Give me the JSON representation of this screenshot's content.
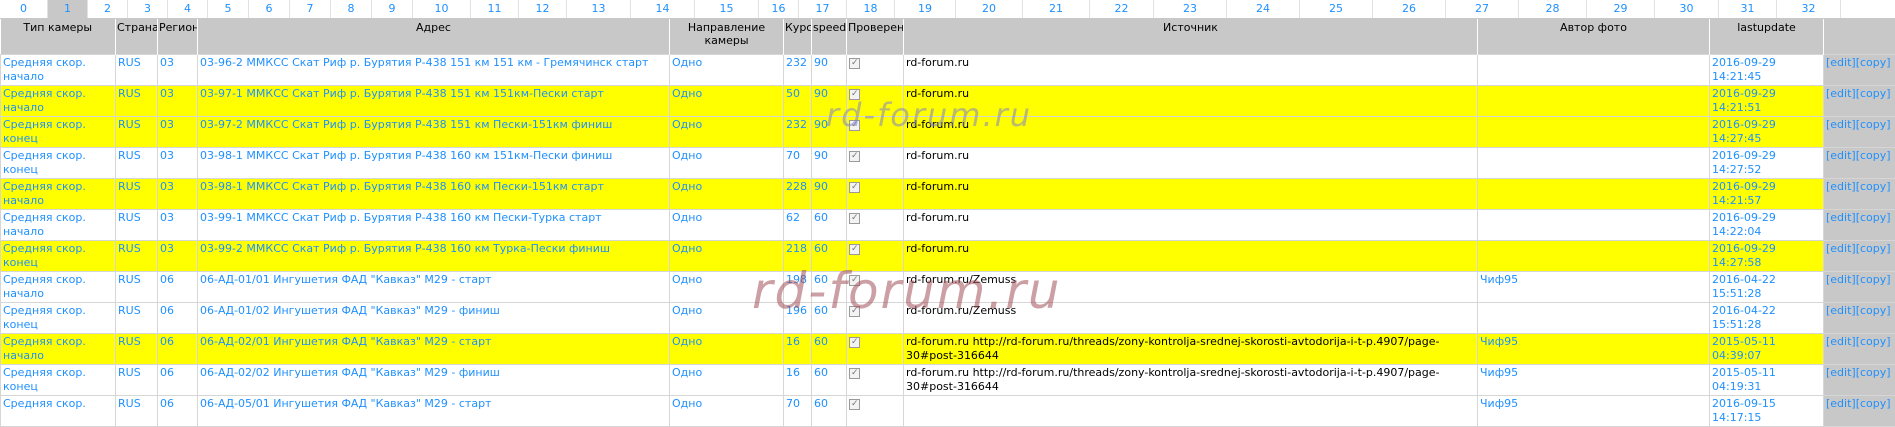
{
  "pager": [
    "0",
    "1",
    "2",
    "3",
    "4",
    "5",
    "6",
    "7",
    "8",
    "9",
    "10",
    "11",
    "12",
    "13",
    "14",
    "15",
    "16",
    "17",
    "18",
    "19",
    "20",
    "21",
    "22",
    "23",
    "24",
    "25",
    "26",
    "27",
    "28",
    "29",
    "30",
    "31",
    "32"
  ],
  "pager_active": "1",
  "headers": {
    "type": "Тип камеры",
    "country": "Страна",
    "region": "Регион",
    "address": "Адрес",
    "direction": "Направление камеры",
    "course": "Курс",
    "speed": "speed",
    "checked": "Проверено",
    "source": "Источник",
    "author": "Автор фото",
    "lastupdate": "lastupdate"
  },
  "action_label": "[edit][copy]",
  "rows": [
    {
      "type": "Средняя скор. начало",
      "country": "RUS",
      "region": "03",
      "address": "03-96-2 ММКСС Скат Риф р. Бурятия Р-438 151 км 151 км - Гремячинск старт",
      "direction": "Одно",
      "course": "232",
      "speed": "90",
      "source": "rd-forum.ru",
      "author": "",
      "lastupdate": "2016-09-29 14:21:45",
      "highlight": false
    },
    {
      "type": "Средняя скор. начало",
      "country": "RUS",
      "region": "03",
      "address": "03-97-1 ММКСС Скат Риф р. Бурятия Р-438 151 км 151км-Пески старт",
      "direction": "Одно",
      "course": "50",
      "speed": "90",
      "source": "rd-forum.ru",
      "author": "",
      "lastupdate": "2016-09-29 14:21:51",
      "highlight": true
    },
    {
      "type": "Средняя скор. конец",
      "country": "RUS",
      "region": "03",
      "address": "03-97-2 ММКСС Скат Риф р. Бурятия Р-438 151 км Пески-151км финиш",
      "direction": "Одно",
      "course": "232",
      "speed": "90",
      "source": "rd-forum.ru",
      "author": "",
      "lastupdate": "2016-09-29 14:27:45",
      "highlight": true
    },
    {
      "type": "Средняя скор. конец",
      "country": "RUS",
      "region": "03",
      "address": "03-98-1 ММКСС Скат Риф р. Бурятия Р-438 160 км 151км-Пески финиш",
      "direction": "Одно",
      "course": "70",
      "speed": "90",
      "source": "rd-forum.ru",
      "author": "",
      "lastupdate": "2016-09-29 14:27:52",
      "highlight": false
    },
    {
      "type": "Средняя скор. начало",
      "country": "RUS",
      "region": "03",
      "address": "03-98-1 ММКСС Скат Риф р. Бурятия Р-438 160 км Пески-151км старт",
      "direction": "Одно",
      "course": "228",
      "speed": "90",
      "source": "rd-forum.ru",
      "author": "",
      "lastupdate": "2016-09-29 14:21:57",
      "highlight": true
    },
    {
      "type": "Средняя скор. начало",
      "country": "RUS",
      "region": "03",
      "address": "03-99-1 ММКСС Скат Риф р. Бурятия Р-438 160 км Пески-Турка старт",
      "direction": "Одно",
      "course": "62",
      "speed": "60",
      "source": "rd-forum.ru",
      "author": "",
      "lastupdate": "2016-09-29 14:22:04",
      "highlight": false
    },
    {
      "type": "Средняя скор. конец",
      "country": "RUS",
      "region": "03",
      "address": "03-99-2 ММКСС Скат Риф р. Бурятия Р-438 160 км Турка-Пески финиш",
      "direction": "Одно",
      "course": "218",
      "speed": "60",
      "source": "rd-forum.ru",
      "author": "",
      "lastupdate": "2016-09-29 14:27:58",
      "highlight": true
    },
    {
      "type": "Средняя скор. начало",
      "country": "RUS",
      "region": "06",
      "address": "06-АД-01/01 Ингушетия ФАД \"Кавказ\" М29 - старт",
      "direction": "Одно",
      "course": "198",
      "speed": "60",
      "source": "rd-forum.ru/Zemuss",
      "author": "Чиф95",
      "lastupdate": "2016-04-22 15:51:28",
      "highlight": false
    },
    {
      "type": "Средняя скор. конец",
      "country": "RUS",
      "region": "06",
      "address": "06-АД-01/02 Ингушетия ФАД \"Кавказ\" М29 - финиш",
      "direction": "Одно",
      "course": "196",
      "speed": "60",
      "source": "rd-forum.ru/Zemuss",
      "author": "",
      "lastupdate": "2016-04-22 15:51:28",
      "highlight": false
    },
    {
      "type": "Средняя скор. начало",
      "country": "RUS",
      "region": "06",
      "address": "06-АД-02/01 Ингушетия ФАД \"Кавказ\" М29 - старт",
      "direction": "Одно",
      "course": "16",
      "speed": "60",
      "source": "rd-forum.ru http://rd-forum.ru/threads/zony-kontrolja-srednej-skorosti-avtodorija-i-t-p.4907/page-30#post-316644",
      "author": "Чиф95",
      "lastupdate": "2015-05-11 04:39:07",
      "highlight": true
    },
    {
      "type": "Средняя скор. конец",
      "country": "RUS",
      "region": "06",
      "address": "06-АД-02/02 Ингушетия ФАД \"Кавказ\" М29 - финиш",
      "direction": "Одно",
      "course": "16",
      "speed": "60",
      "source": "rd-forum.ru http://rd-forum.ru/threads/zony-kontrolja-srednej-skorosti-avtodorija-i-t-p.4907/page-30#post-316644",
      "author": "Чиф95",
      "lastupdate": "2015-05-11 04:19:31",
      "highlight": false
    },
    {
      "type": "Средняя скор.",
      "country": "RUS",
      "region": "06",
      "address": "06-АД-05/01 Ингушетия ФАД \"Кавказ\" М29 - старт",
      "direction": "Одно",
      "course": "70",
      "speed": "60",
      "source": "",
      "author": "Чиф95",
      "lastupdate": "2016-09-15 14:17:15",
      "highlight": false
    }
  ],
  "watermark_1": "rd-forum.ru",
  "watermark_2": "rd-forum.ru"
}
